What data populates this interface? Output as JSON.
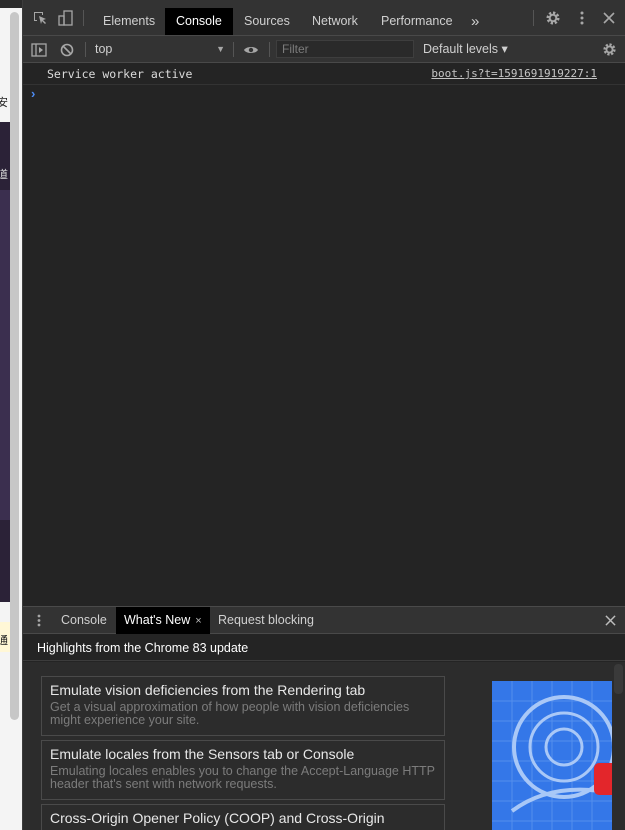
{
  "main_tabs": [
    {
      "label": "Elements"
    },
    {
      "label": "Console"
    },
    {
      "label": "Sources"
    },
    {
      "label": "Network"
    },
    {
      "label": "Performance"
    }
  ],
  "more_tabs_glyph": "»",
  "console_toolbar": {
    "context": "top",
    "context_arrow": "▼",
    "filter_placeholder": "Filter",
    "levels_label": "Default levels ▾"
  },
  "messages": [
    {
      "text": "Service worker active",
      "source": "boot.js?t=1591691919227:1"
    }
  ],
  "prompt_glyph": "›",
  "drawer": {
    "tabs": [
      {
        "label": "Console"
      },
      {
        "label": "What's New",
        "close": "×"
      },
      {
        "label": "Request blocking"
      }
    ],
    "header": "Highlights from the Chrome 83 update",
    "cards": [
      {
        "title": "Emulate vision deficiencies from the Rendering tab",
        "desc": "Get a visual approximation of how people with vision deficiencies might experience your site."
      },
      {
        "title": "Emulate locales from the Sensors tab or Console",
        "desc": "Emulating locales enables you to change the Accept-Language HTTP header that's sent with network requests."
      },
      {
        "title": "Cross-Origin Opener Policy (COOP) and Cross-Origin",
        "desc": ""
      }
    ]
  },
  "colors": {
    "toolbar_bg": "#333333",
    "panel_bg": "#242424",
    "active_tab_bg": "#000000",
    "prompt": "#4d8cf5",
    "promo_blue": "#3477e8"
  },
  "page_strip_glyphs": [
    "安",
    "道",
    "通"
  ]
}
